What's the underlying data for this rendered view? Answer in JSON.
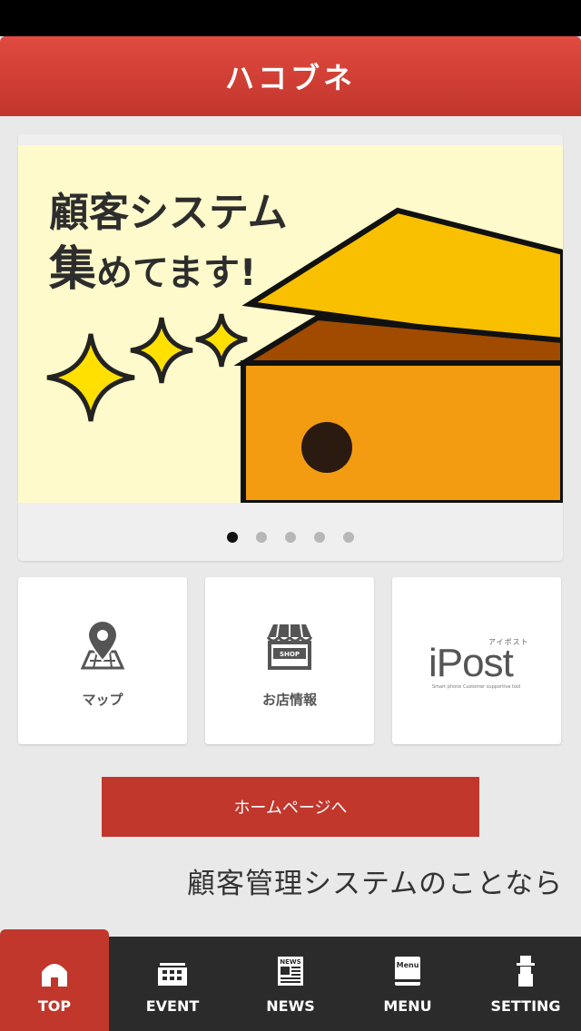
{
  "header": {
    "title": "ハコブネ"
  },
  "banner": {
    "line1": "顧客システム",
    "line2_big": "集",
    "line2_rest": "めてます!"
  },
  "carousel": {
    "dot_count": 5,
    "active_index": 0
  },
  "tiles": [
    {
      "label": "マップ",
      "icon": "map-pin-icon"
    },
    {
      "label": "お店情報",
      "icon": "shop-icon",
      "badge": "SHOP"
    },
    {
      "label": "",
      "icon": "ipost-logo",
      "logo_kana": "アイポスト",
      "logo_word": "iPost",
      "logo_tagline": "Smart phone  Customer supportive tool"
    }
  ],
  "home_button": {
    "label": "ホームページへ"
  },
  "marquee": {
    "text": "顧客管理システムのことなら"
  },
  "tabs": [
    {
      "label": "TOP",
      "icon": "home-icon",
      "active": true
    },
    {
      "label": "EVENT",
      "icon": "calendar-icon",
      "active": false
    },
    {
      "label": "NEWS",
      "icon": "newspaper-icon",
      "active": false,
      "icon_text": "NEWS"
    },
    {
      "label": "MENU",
      "icon": "menu-book-icon",
      "active": false,
      "icon_text": "Menu"
    },
    {
      "label": "SETTING",
      "icon": "person-setting-icon",
      "active": false
    }
  ],
  "colors": {
    "header_red": "#c1352b",
    "tab_bar": "#2b2b2b",
    "banner_bg": "#fffacb"
  }
}
